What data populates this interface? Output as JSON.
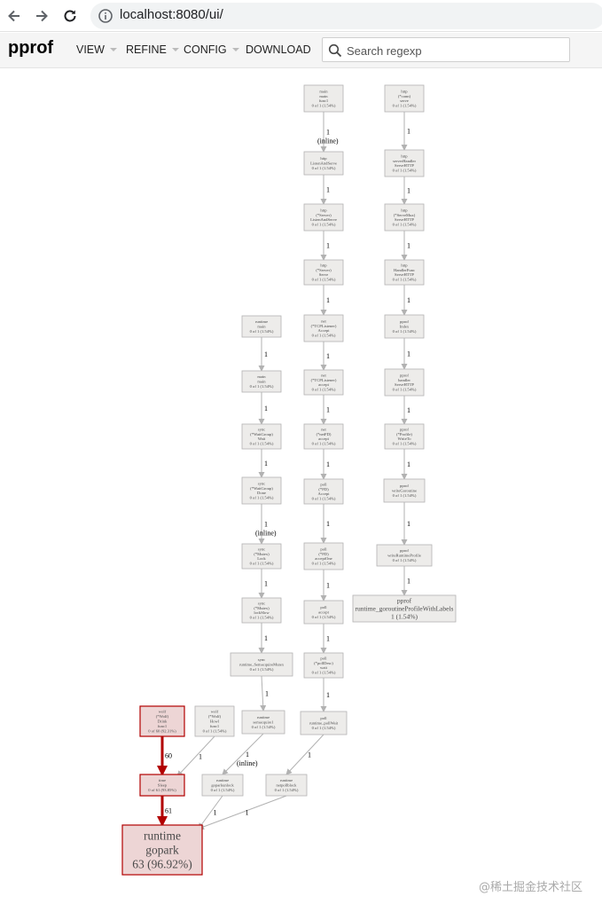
{
  "browser": {
    "url": "localhost:8080/ui/",
    "icons": [
      "back-arrow-icon",
      "forward-arrow-icon",
      "reload-icon",
      "info-icon"
    ]
  },
  "header": {
    "title": "pprof",
    "menus": [
      "VIEW",
      "REFINE",
      "CONFIG",
      "DOWNLOAD"
    ],
    "search_placeholder": "Search regexp"
  },
  "colors": {
    "hot_edge": "#b20000",
    "hot_node_fill": "#edd5d5",
    "hot_node_stroke": "#b20000",
    "cold_node_fill": "#edecea",
    "cold_node_stroke": "#b2b2b2",
    "cold_edge": "#b2b2b2"
  },
  "graph": {
    "nodes": [
      {
        "id": "main_main",
        "lines": [
          "main",
          "main",
          "func1",
          "0 of 1 (1.54%)"
        ]
      },
      {
        "id": "http_ListenAndServe",
        "lines": [
          "http",
          "ListenAndServe",
          "0 of 1 (1.54%)"
        ]
      },
      {
        "id": "http_Server_ListenAndServe",
        "lines": [
          "http",
          "(*Server)",
          "ListenAndServe",
          "0 of 1 (1.54%)"
        ]
      },
      {
        "id": "http_Server_Serve",
        "lines": [
          "http",
          "(*Server)",
          "Serve",
          "0 of 1 (1.54%)"
        ]
      },
      {
        "id": "net_TCPListener_Accept",
        "lines": [
          "net",
          "(*TCPListener)",
          "Accept",
          "0 of 1 (1.54%)"
        ]
      },
      {
        "id": "net_TCPListener_accept",
        "lines": [
          "net",
          "(*TCPListener)",
          "accept",
          "0 of 1 (1.54%)"
        ]
      },
      {
        "id": "net_netFD_accept",
        "lines": [
          "net",
          "(*netFD)",
          "accept",
          "0 of 1 (1.54%)"
        ]
      },
      {
        "id": "poll_FD_Accept",
        "lines": [
          "poll",
          "(*FD)",
          "Accept",
          "0 of 1 (1.54%)"
        ]
      },
      {
        "id": "poll_FD_acceptOne",
        "lines": [
          "poll",
          "(*FD)",
          "acceptOne",
          "0 of 1 (1.54%)"
        ]
      },
      {
        "id": "poll_accept",
        "lines": [
          "poll",
          "accept",
          "0 of 1 (1.54%)"
        ]
      },
      {
        "id": "poll_pollDesc_wait",
        "lines": [
          "poll",
          "(*pollDesc)",
          "wait",
          "0 of 1 (1.54%)"
        ]
      },
      {
        "id": "poll_runtime_pollWait",
        "lines": [
          "poll",
          "runtime_pollWait",
          "0 of 1 (1.54%)"
        ]
      },
      {
        "id": "runtime_netpollblock",
        "lines": [
          "runtime",
          "netpollblock",
          "0 of 1 (1.54%)"
        ]
      },
      {
        "id": "http_conn_serve",
        "lines": [
          "http",
          "(*conn)",
          "serve",
          "0 of 1 (1.54%)"
        ]
      },
      {
        "id": "http_serverHandler_ServeHTTP",
        "lines": [
          "http",
          "serverHandler",
          "ServeHTTP",
          "0 of 1 (1.54%)"
        ]
      },
      {
        "id": "http_ServeMux_ServeHTTP",
        "lines": [
          "http",
          "(*ServeMux)",
          "ServeHTTP",
          "0 of 1 (1.54%)"
        ]
      },
      {
        "id": "http_HandlerFunc_ServeHTTP",
        "lines": [
          "http",
          "HandlerFunc",
          "ServeHTTP",
          "0 of 1 (1.54%)"
        ]
      },
      {
        "id": "pprof_Index",
        "lines": [
          "pprof",
          "Index",
          "0 of 1 (1.54%)"
        ]
      },
      {
        "id": "pprof_handler_ServeHTTP",
        "lines": [
          "pprof",
          "handler",
          "ServeHTTP",
          "0 of 1 (1.54%)"
        ]
      },
      {
        "id": "pprof_Profile_WriteTo",
        "lines": [
          "pprof",
          "(*Profile)",
          "WriteTo",
          "0 of 1 (1.54%)"
        ]
      },
      {
        "id": "pprof_writeGoroutine",
        "lines": [
          "pprof",
          "writeGoroutine",
          "0 of 1 (1.54%)"
        ]
      },
      {
        "id": "pprof_writeRuntimeProfile",
        "lines": [
          "pprof",
          "writeRuntimeProfile",
          "0 of 1 (1.54%)"
        ]
      },
      {
        "id": "pprof_runtime_goroutineProfileWithLabels",
        "lines": [
          "pprof",
          "runtime_goroutineProfileWithLabels",
          "1 (1.54%)"
        ]
      },
      {
        "id": "runtime_main",
        "lines": [
          "runtime",
          "main",
          "0 of 1 (1.54%)"
        ]
      },
      {
        "id": "main_main2",
        "lines": [
          "main",
          "main",
          "0 of 1 (1.54%)"
        ]
      },
      {
        "id": "sync_WaitGroup_Wait",
        "lines": [
          "sync",
          "(*WaitGroup)",
          "Wait",
          "0 of 1 (1.54%)"
        ]
      },
      {
        "id": "sync_WaitGroup_Done",
        "lines": [
          "sync",
          "(*WaitGroup)",
          "Done",
          "0 of 1 (1.54%)"
        ]
      },
      {
        "id": "sync_Mutex_Lock",
        "lines": [
          "sync",
          "(*Mutex)",
          "Lock",
          "0 of 1 (1.54%)"
        ]
      },
      {
        "id": "sync_Mutex_lockSlow",
        "lines": [
          "sync",
          "(*Mutex)",
          "lockSlow",
          "0 of 1 (1.54%)"
        ]
      },
      {
        "id": "sync_runtime_SemacquireMutex",
        "lines": [
          "sync",
          "runtime_SemacquireMutex",
          "0 of 1 (1.54%)"
        ]
      },
      {
        "id": "runtime_semacquire1",
        "lines": [
          "runtime",
          "semacquire1",
          "0 of 1 (1.54%)"
        ]
      },
      {
        "id": "runtime_goparkunlock",
        "lines": [
          "runtime",
          "goparkunlock",
          "0 of 1 (1.54%)"
        ]
      },
      {
        "id": "main_Wolf_Drink",
        "lines": [
          "wolf",
          "(*Wolf)",
          "Drink",
          "func1",
          "0 of 60 (92.31%)"
        ]
      },
      {
        "id": "main_Wolf_Howl",
        "lines": [
          "wolf",
          "(*Wolf)",
          "Howl",
          "func1",
          "0 of 1 (1.54%)"
        ]
      },
      {
        "id": "time_Sleep",
        "lines": [
          "time",
          "Sleep",
          "0 of 61 (93.85%)"
        ]
      },
      {
        "id": "runtime_gopark",
        "lines": [
          "runtime",
          "gopark",
          "63 (96.92%)"
        ]
      }
    ],
    "edges": [
      {
        "from": "main_main",
        "to": "http_ListenAndServe",
        "label": "1",
        "sub": "(inline)"
      },
      {
        "from": "http_ListenAndServe",
        "to": "http_Server_ListenAndServe",
        "label": "1"
      },
      {
        "from": "http_Server_ListenAndServe",
        "to": "http_Server_Serve",
        "label": "1"
      },
      {
        "from": "http_Server_Serve",
        "to": "net_TCPListener_Accept",
        "label": "1"
      },
      {
        "from": "net_TCPListener_Accept",
        "to": "net_TCPListener_accept",
        "label": "1"
      },
      {
        "from": "net_TCPListener_accept",
        "to": "net_netFD_accept",
        "label": "1"
      },
      {
        "from": "net_netFD_accept",
        "to": "poll_FD_Accept",
        "label": "1"
      },
      {
        "from": "poll_FD_Accept",
        "to": "poll_FD_acceptOne",
        "label": "1"
      },
      {
        "from": "poll_FD_acceptOne",
        "to": "poll_accept",
        "label": "1"
      },
      {
        "from": "poll_accept",
        "to": "poll_pollDesc_wait",
        "label": "1"
      },
      {
        "from": "poll_pollDesc_wait",
        "to": "poll_runtime_pollWait",
        "label": "1"
      },
      {
        "from": "poll_runtime_pollWait",
        "to": "runtime_netpollblock",
        "label": "1"
      },
      {
        "from": "runtime_netpollblock",
        "to": "runtime_gopark",
        "label": "1"
      },
      {
        "from": "http_conn_serve",
        "to": "http_serverHandler_ServeHTTP",
        "label": "1"
      },
      {
        "from": "http_serverHandler_ServeHTTP",
        "to": "http_ServeMux_ServeHTTP",
        "label": "1"
      },
      {
        "from": "http_ServeMux_ServeHTTP",
        "to": "http_HandlerFunc_ServeHTTP",
        "label": "1"
      },
      {
        "from": "http_HandlerFunc_ServeHTTP",
        "to": "pprof_Index",
        "label": "1"
      },
      {
        "from": "pprof_Index",
        "to": "pprof_handler_ServeHTTP",
        "label": "1"
      },
      {
        "from": "pprof_handler_ServeHTTP",
        "to": "pprof_Profile_WriteTo",
        "label": "1"
      },
      {
        "from": "pprof_Profile_WriteTo",
        "to": "pprof_writeGoroutine",
        "label": "1"
      },
      {
        "from": "pprof_writeGoroutine",
        "to": "pprof_writeRuntimeProfile",
        "label": "1"
      },
      {
        "from": "pprof_writeRuntimeProfile",
        "to": "pprof_runtime_goroutineProfileWithLabels",
        "label": "1"
      },
      {
        "from": "runtime_main",
        "to": "main_main2",
        "label": "1"
      },
      {
        "from": "main_main2",
        "to": "sync_WaitGroup_Wait",
        "label": "1"
      },
      {
        "from": "sync_WaitGroup_Wait",
        "to": "sync_WaitGroup_Done",
        "label": "1"
      },
      {
        "from": "sync_WaitGroup_Done",
        "to": "sync_Mutex_Lock",
        "label": "1",
        "sub": "(inline)"
      },
      {
        "from": "sync_Mutex_Lock",
        "to": "sync_Mutex_lockSlow",
        "label": "1"
      },
      {
        "from": "sync_Mutex_lockSlow",
        "to": "sync_runtime_SemacquireMutex",
        "label": "1"
      },
      {
        "from": "sync_runtime_SemacquireMutex",
        "to": "runtime_semacquire1",
        "label": "1"
      },
      {
        "from": "runtime_semacquire1",
        "to": "runtime_goparkunlock",
        "label": "1",
        "sub": "(inline)"
      },
      {
        "from": "runtime_goparkunlock",
        "to": "runtime_gopark",
        "label": "1"
      },
      {
        "from": "main_Wolf_Drink",
        "to": "time_Sleep",
        "label": "60",
        "hot": true
      },
      {
        "from": "main_Wolf_Howl",
        "to": "time_Sleep",
        "label": "1"
      },
      {
        "from": "time_Sleep",
        "to": "runtime_gopark",
        "label": "61",
        "hot": true
      }
    ]
  },
  "watermark": "@稀土掘金技术社区"
}
